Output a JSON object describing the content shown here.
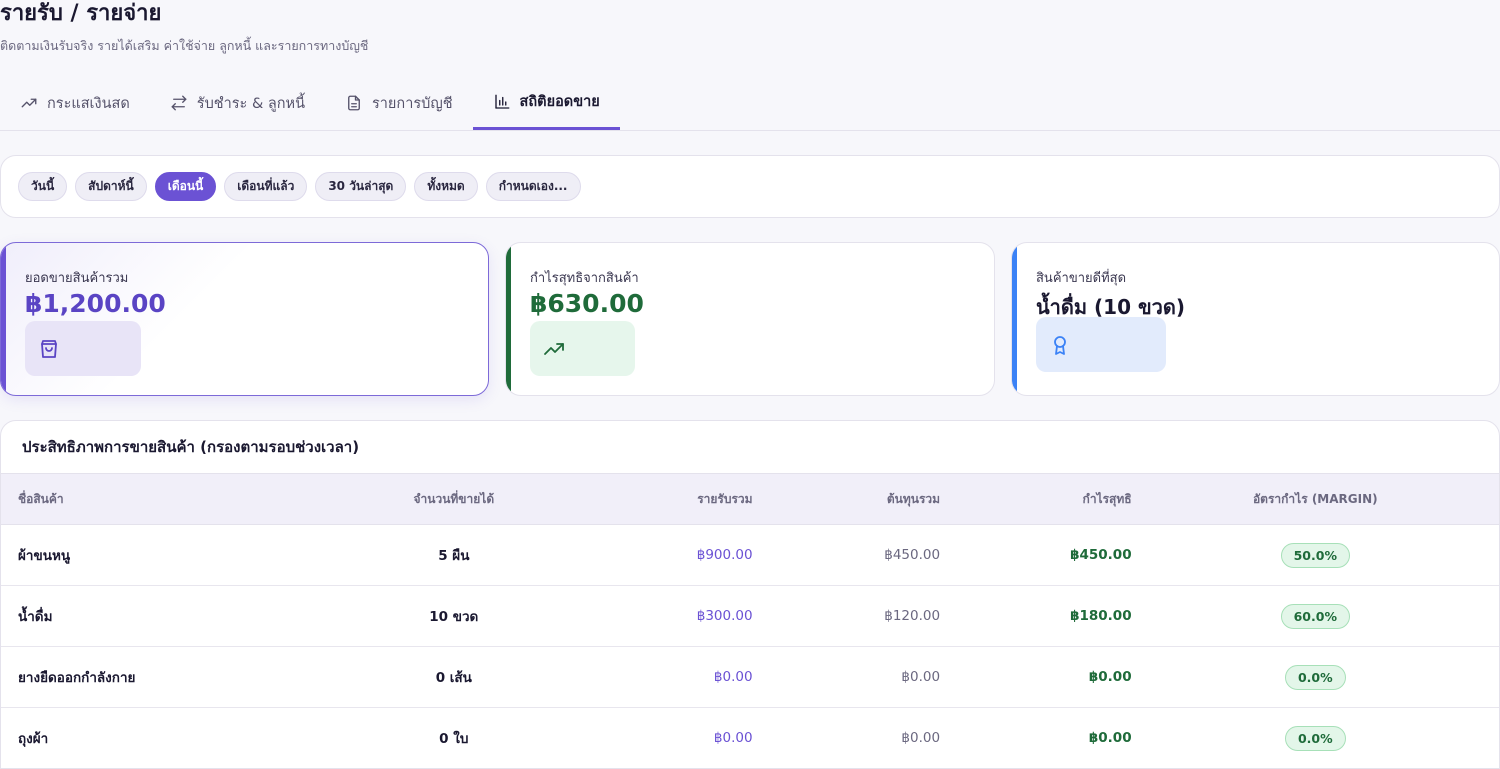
{
  "header": {
    "title": "รายรับ / รายจ่าย",
    "subtitle": "ติดตามเงินรับจริง รายได้เสริม ค่าใช้จ่าย ลูกหนี้ และรายการทางบัญชี"
  },
  "tabs": [
    {
      "label": "กระแสเงินสด",
      "icon": "trending-up-icon"
    },
    {
      "label": "รับชำระ & ลูกหนี้",
      "icon": "transfer-icon"
    },
    {
      "label": "รายการบัญชี",
      "icon": "document-icon"
    },
    {
      "label": "สถิติยอดขาย",
      "icon": "bar-chart-icon",
      "active": true
    }
  ],
  "filters": [
    "วันนี้",
    "สัปดาห์นี้",
    "เดือนนี้",
    "เดือนที่แล้ว",
    "30 วันล่าสุด",
    "ทั้งหมด",
    "กำหนดเอง..."
  ],
  "active_filter": "เดือนนี้",
  "stats": {
    "total_sales": {
      "label": "ยอดขายสินค้ารวม",
      "value": "฿1,200.00",
      "icon": "shopping-bag-icon"
    },
    "net_profit": {
      "label": "กำไรสุทธิจากสินค้า",
      "value": "฿630.00",
      "icon": "trending-up-icon"
    },
    "best_seller": {
      "label": "สินค้าขายดีที่สุด",
      "value": "น้ำดื่ม (10 ขวด)",
      "icon": "award-icon"
    }
  },
  "colors": {
    "accent": "#6b52d4",
    "profit": "#1f6b3a",
    "info": "#3b82f6"
  },
  "table": {
    "title": "ประสิทธิภาพการขายสินค้า (กรองตามรอบช่วงเวลา)",
    "columns": [
      "ชื่อสินค้า",
      "จำนวนที่ขายได้",
      "รายรับรวม",
      "ต้นทุนรวม",
      "กำไรสุทธิ",
      "อัตรากำไร (MARGIN)"
    ],
    "rows": [
      {
        "name": "ผ้าขนหนู",
        "qty": "5 ผืน",
        "revenue": "฿900.00",
        "cost": "฿450.00",
        "profit": "฿450.00",
        "margin": "50.0%"
      },
      {
        "name": "น้ำดื่ม",
        "qty": "10 ขวด",
        "revenue": "฿300.00",
        "cost": "฿120.00",
        "profit": "฿180.00",
        "margin": "60.0%"
      },
      {
        "name": "ยางยืดออกกำลังกาย",
        "qty": "0 เส้น",
        "revenue": "฿0.00",
        "cost": "฿0.00",
        "profit": "฿0.00",
        "margin": "0.0%"
      },
      {
        "name": "ถุงผ้า",
        "qty": "0 ใบ",
        "revenue": "฿0.00",
        "cost": "฿0.00",
        "profit": "฿0.00",
        "margin": "0.0%"
      }
    ]
  }
}
